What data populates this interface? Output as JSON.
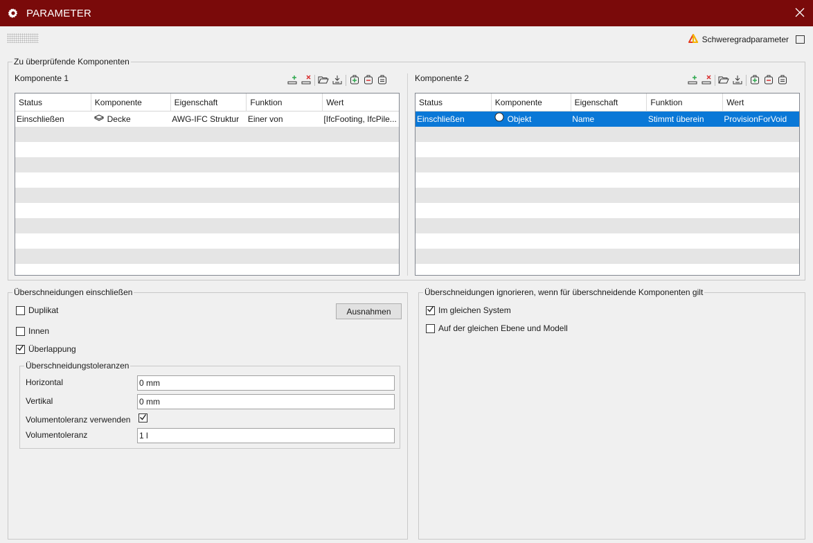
{
  "window": {
    "title": "PARAMETER"
  },
  "severity": {
    "label": "Schweregradparameter"
  },
  "components_group": {
    "legend": "Zu überprüfende Komponenten",
    "k1": {
      "title": "Komponente 1",
      "columns": [
        "Status",
        "Komponente",
        "Eigenschaft",
        "Funktion",
        "Wert"
      ],
      "rows": [
        {
          "status": "Einschließen",
          "komponente": "Decke",
          "komponente_icon": "slab-icon",
          "eigenschaft": "AWG-IFC Struktur",
          "funktion": "Einer von",
          "wert": "[IfcFooting, IfcPile..."
        }
      ]
    },
    "k2": {
      "title": "Komponente 2",
      "columns": [
        "Status",
        "Komponente",
        "Eigenschaft",
        "Funktion",
        "Wert"
      ],
      "rows": [
        {
          "status": "Einschließen",
          "komponente": "Objekt",
          "komponente_icon": "object-circle-icon",
          "eigenschaft": "Name",
          "funktion": "Stimmt überein",
          "wert": "ProvisionForVoid"
        }
      ]
    }
  },
  "include_group": {
    "legend": "Überschneidungen einschließen",
    "duplikat": {
      "label": "Duplikat",
      "checked": false
    },
    "innen": {
      "label": "Innen",
      "checked": false
    },
    "ueberlappung": {
      "label": "Überlappung",
      "checked": true
    },
    "exceptions_button": "Ausnahmen",
    "tolerances": {
      "legend": "Überschneidungstoleranzen",
      "horizontal_label": "Horizontal",
      "horizontal_value": "0 mm",
      "vertikal_label": "Vertikal",
      "vertikal_value": "0 mm",
      "use_volume_label": "Volumentoleranz verwenden",
      "use_volume_checked": true,
      "volume_label": "Volumentoleranz",
      "volume_value": "1 l"
    }
  },
  "ignore_group": {
    "legend": "Überschneidungen ignorieren, wenn für überschneidende Komponenten gilt",
    "same_system": {
      "label": "Im gleichen System",
      "checked": true
    },
    "same_level": {
      "label": "Auf der gleichen Ebene und Modell",
      "checked": false
    }
  },
  "colors": {
    "titlebar": "#7a0a0a",
    "selection": "#0a78d7",
    "alt_row": "#e5e5e5",
    "add_green": "#2fa84f",
    "remove_red": "#d93030"
  }
}
